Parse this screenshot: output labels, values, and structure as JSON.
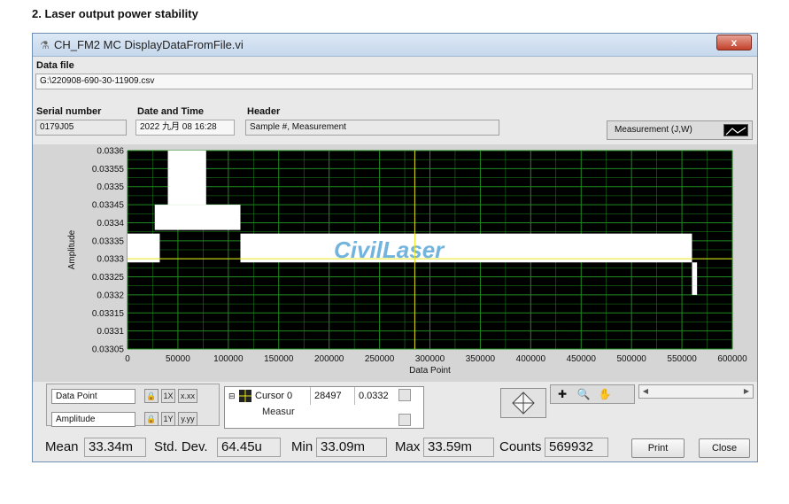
{
  "doc_heading": "2.   Laser output power stability",
  "window": {
    "title": "CH_FM2 MC DisplayDataFromFile.vi",
    "close_glyph": "x"
  },
  "data_file": {
    "label": "Data file",
    "value": "G:\\220908-690-30-11909.csv"
  },
  "serial": {
    "label": "Serial number",
    "value": "0179J05"
  },
  "datetime": {
    "label": "Date and Time",
    "value": "2022 九月 08 16:28"
  },
  "header": {
    "label": "Header",
    "value": "Sample #, Measurement"
  },
  "legend": {
    "label": "Measurement (J,W)"
  },
  "watermark": "CivilLaser",
  "chart_data": {
    "type": "line",
    "xlabel": "Data Point",
    "ylabel": "Amplitude",
    "xlim": [
      0,
      600000
    ],
    "ylim": [
      0.03305,
      0.0336
    ],
    "x_ticks": [
      "0",
      "50000",
      "100000",
      "150000",
      "200000",
      "250000",
      "300000",
      "350000",
      "400000",
      "450000",
      "500000",
      "550000",
      "600000"
    ],
    "y_ticks": [
      "0.0336",
      "0.03355",
      "0.0335",
      "0.03345",
      "0.0334",
      "0.03335",
      "0.0333",
      "0.03325",
      "0.0332",
      "0.03315",
      "0.0331",
      "0.03305"
    ],
    "grid": true,
    "background": "#000000",
    "grid_color": "#1f8a1f",
    "series_color": "#ffffff",
    "cursor_color": "#e8e81a",
    "cursor": {
      "x": 284972,
      "y": 0.0333
    },
    "bands": [
      {
        "x0": 0,
        "x1": 32000,
        "y0": 0.03329,
        "y1": 0.03337
      },
      {
        "x0": 27000,
        "x1": 112000,
        "y0": 0.03338,
        "y1": 0.03345
      },
      {
        "x0": 40000,
        "x1": 78000,
        "y0": 0.03345,
        "y1": 0.0336
      },
      {
        "x0": 112000,
        "x1": 560000,
        "y0": 0.03329,
        "y1": 0.03337
      },
      {
        "x0": 560000,
        "x1": 565000,
        "y0": 0.0332,
        "y1": 0.03329
      }
    ]
  },
  "cursor_panel": {
    "x_name": "Data Point",
    "y_name": "Amplitude",
    "cursor_name": "Cursor 0",
    "cursor_x": "28497",
    "cursor_y": "0.0332",
    "plot_name": "Measur",
    "btn_x1": "1X",
    "btn_x2": "x.xx",
    "btn_y1": "1Y",
    "btn_y2": "y.yy"
  },
  "stats": {
    "mean_label": "Mean",
    "mean": "33.34m",
    "std_label": "Std. Dev.",
    "std": "64.45u",
    "min_label": "Min",
    "min": "33.09m",
    "max_label": "Max",
    "max": "33.59m",
    "counts_label": "Counts",
    "counts": "569932"
  },
  "buttons": {
    "print": "Print",
    "close": "Close"
  }
}
